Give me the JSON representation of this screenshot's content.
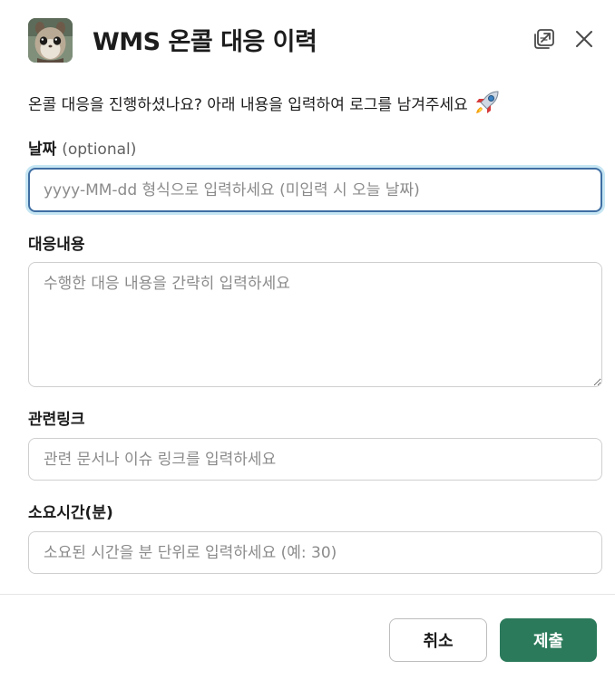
{
  "modal": {
    "title": "WMS 온콜 대응 이력",
    "intro": "온콜 대응을 진행하셨나요? 아래 내용을 입력하여 로그를 남겨주세요"
  },
  "fields": {
    "date": {
      "label": "날짜",
      "optional": "(optional)",
      "placeholder": "yyyy-MM-dd 형식으로 입력하세요 (미입력 시 오늘 날짜)",
      "value": ""
    },
    "content": {
      "label": "대응내용",
      "placeholder": "수행한 대응 내용을 간략히 입력하세요",
      "value": ""
    },
    "link": {
      "label": "관련링크",
      "placeholder": "관련 문서나 이슈 링크를 입력하세요",
      "value": ""
    },
    "duration": {
      "label": "소요시간(분)",
      "placeholder": "소요된 시간을 분 단위로 입력하세요 (예: 30)",
      "value": ""
    }
  },
  "footer": {
    "cancel_label": "취소",
    "submit_label": "제출"
  },
  "icons": {
    "avatar": "squirrel-avatar-icon",
    "popout": "popout-icon",
    "close": "close-icon",
    "rocket": "rocket-icon"
  },
  "colors": {
    "submit": "#2b7a5b",
    "focus_border": "#3f6ea3"
  }
}
